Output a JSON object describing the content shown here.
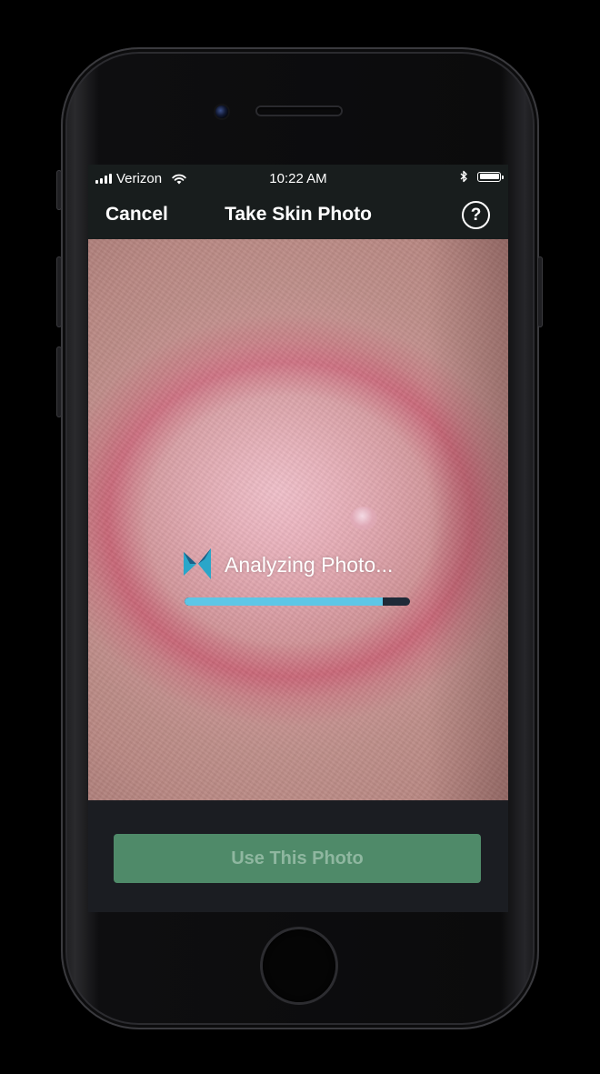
{
  "status_bar": {
    "carrier": "Verizon",
    "time": "10:22 AM"
  },
  "nav": {
    "cancel_label": "Cancel",
    "title": "Take Skin Photo",
    "help_icon": "help-circle-icon",
    "help_label": "?"
  },
  "analysis": {
    "status_text": "Analyzing Photo...",
    "progress": 0.88,
    "logo_icon": "bowtie-logo-icon",
    "progress_color": "#5ec6e6"
  },
  "actions": {
    "use_photo_label": "Use This Photo",
    "button_color": "#4f8a69"
  }
}
